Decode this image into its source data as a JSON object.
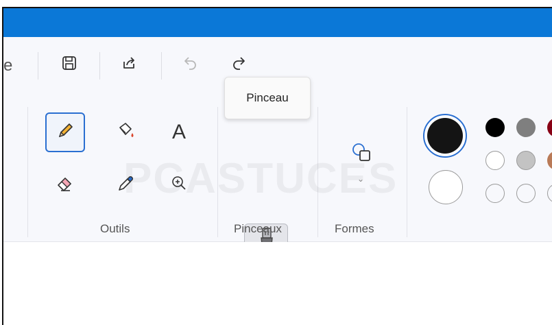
{
  "quick_access": {
    "cut_letter": "e",
    "icons": [
      "save-icon",
      "share-icon",
      "undo-icon",
      "redo-icon"
    ]
  },
  "tooltip": {
    "text": "Pinceau"
  },
  "ribbon": {
    "groups": {
      "outils": "Outils",
      "pinceaux": "Pinceaux",
      "formes": "Formes"
    },
    "text_tool_glyph": "A"
  },
  "watermark": {
    "text": "PCASTUCES"
  },
  "colors": {
    "titlebar": "#0b78d7",
    "accent": "#2a6fd1",
    "primary_color": "#141414",
    "secondary_color": "#ffffff",
    "palette_row1": [
      "#000000",
      "#7f7f7f",
      "#880015"
    ],
    "palette_row2": [
      "#ffffff",
      "#c3c3c3",
      "#b97a57"
    ]
  }
}
